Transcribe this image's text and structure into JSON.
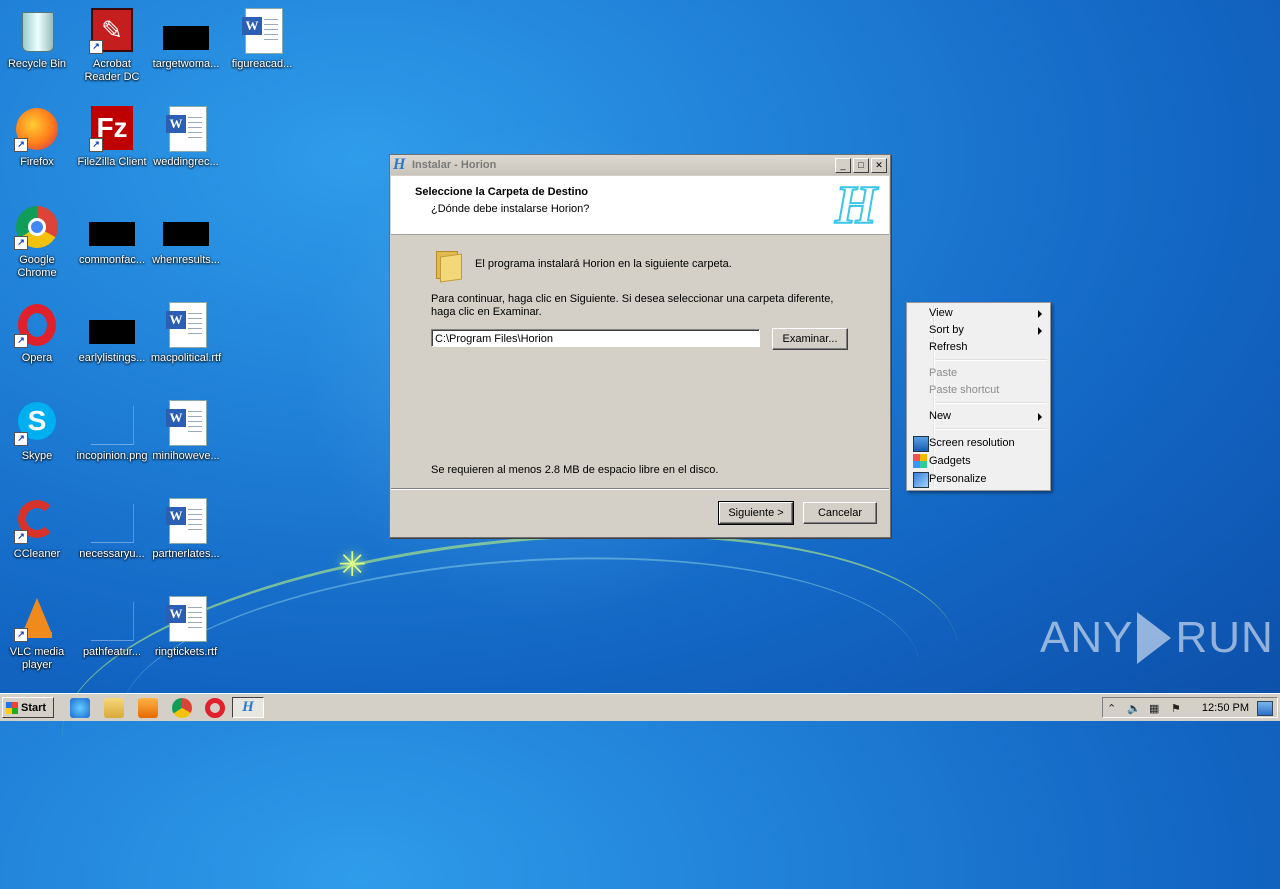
{
  "desktop": {
    "icons": [
      {
        "label": "Recycle Bin"
      },
      {
        "label": "Acrobat Reader DC"
      },
      {
        "label": "targetwoma..."
      },
      {
        "label": "figureacad..."
      },
      {
        "label": "Firefox"
      },
      {
        "label": "FileZilla Client"
      },
      {
        "label": "weddingrec..."
      },
      {
        "label": "Google Chrome"
      },
      {
        "label": "commonfac..."
      },
      {
        "label": "whenresults..."
      },
      {
        "label": "Opera"
      },
      {
        "label": "earlylistings..."
      },
      {
        "label": "macpolitical.rtf"
      },
      {
        "label": "Skype"
      },
      {
        "label": "incopinion.png"
      },
      {
        "label": "minihoweve..."
      },
      {
        "label": "CCleaner"
      },
      {
        "label": "necessaryu..."
      },
      {
        "label": "partnerlates..."
      },
      {
        "label": "VLC media player"
      },
      {
        "label": "pathfeatur..."
      },
      {
        "label": "ringtickets.rtf"
      }
    ]
  },
  "installer": {
    "title": "Instalar - Horion",
    "header_title": "Seleccione la Carpeta de Destino",
    "header_subtitle": "¿Dónde debe instalarse Horion?",
    "logo_letter": "H",
    "info_text": "El programa instalará Horion en la siguiente carpeta.",
    "instruction_line1": "Para continuar, haga clic en Siguiente. Si desea seleccionar una carpeta diferente,",
    "instruction_line2": "haga clic en Examinar.",
    "path_value": "C:\\Program Files\\Horion",
    "browse_label": "Examinar...",
    "space_text": "Se requieren al menos 2.8 MB de espacio libre en el disco.",
    "next_label": "Siguiente >",
    "cancel_label": "Cancelar"
  },
  "context_menu": {
    "view": "View",
    "sort_by": "Sort by",
    "refresh": "Refresh",
    "paste": "Paste",
    "paste_shortcut": "Paste shortcut",
    "new": "New",
    "screen_resolution": "Screen resolution",
    "gadgets": "Gadgets",
    "personalize": "Personalize"
  },
  "watermark": {
    "left": "ANY",
    "right": "RUN"
  },
  "taskbar": {
    "start_label": "Start",
    "clock": "12:50 PM"
  }
}
